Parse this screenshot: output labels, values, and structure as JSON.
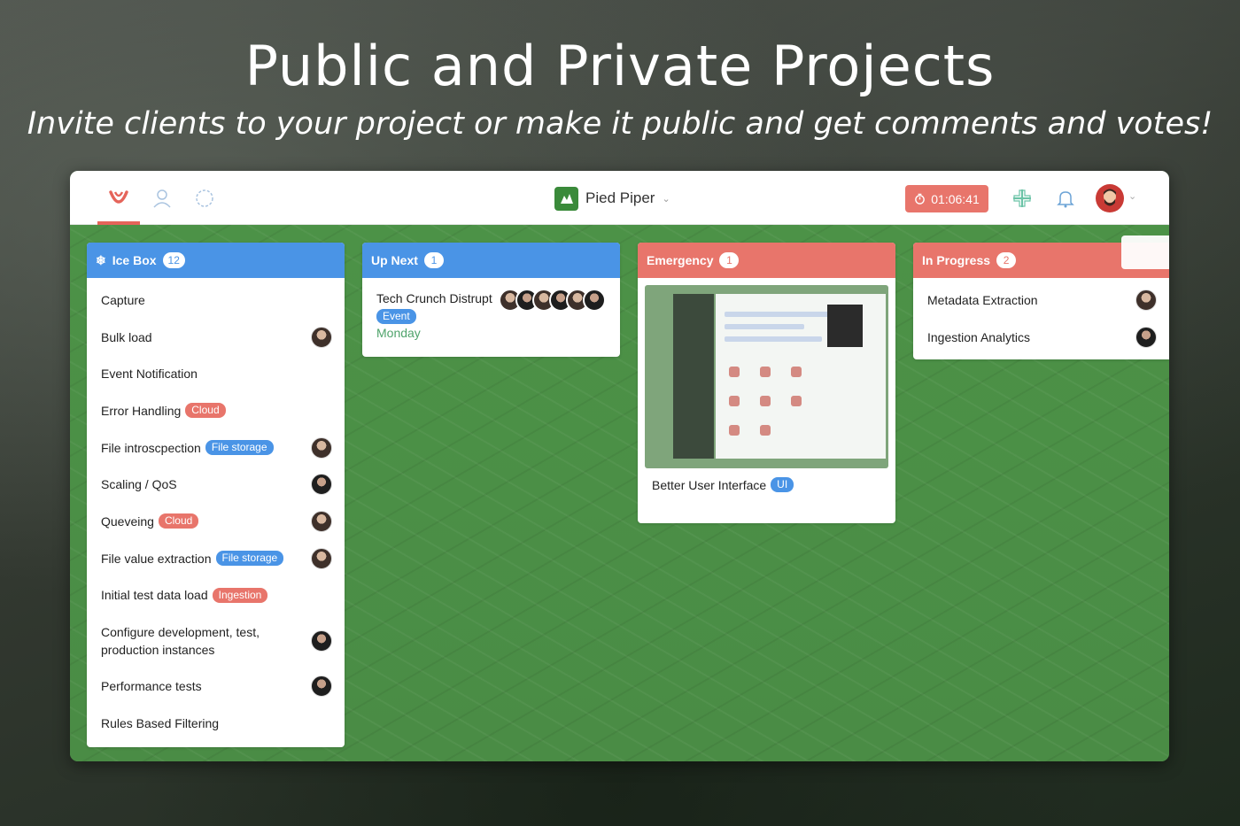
{
  "banner": {
    "title": "Public and Private Projects",
    "subtitle": "Invite clients to your project or make it public and get comments and votes!"
  },
  "topbar": {
    "nav_icons": [
      "logo-icon",
      "user-icon",
      "activity-icon"
    ],
    "project_name": "Pied Piper",
    "timer": "01:06:41",
    "right_icons": [
      "add-icon",
      "bell-icon",
      "avatar"
    ]
  },
  "columns": [
    {
      "title": "Ice Box",
      "count": "12",
      "color": "#4a94e6",
      "cards": [
        {
          "title": "Capture",
          "tag": ""
        },
        {
          "title": "Bulk load",
          "tag": ""
        },
        {
          "title": "Event Notification",
          "tag": ""
        },
        {
          "title": "Error Handling",
          "tag": "Cloud"
        },
        {
          "title": "File introscpection",
          "tag": "File storage"
        },
        {
          "title": "Scaling / QoS",
          "tag": ""
        },
        {
          "title": "Queveing",
          "tag": "Cloud"
        },
        {
          "title": "File value extraction",
          "tag": "File storage"
        },
        {
          "title": "Initial test data load",
          "tag": "Ingestion"
        },
        {
          "title": "Configure development, test, production instances",
          "tag": ""
        },
        {
          "title": "Performance tests",
          "tag": ""
        },
        {
          "title": "Rules Based Filtering",
          "tag": ""
        }
      ]
    },
    {
      "title": "Up Next",
      "count": "1",
      "color": "#4a94e6",
      "cards": [
        {
          "title": "Tech Crunch Distrupt",
          "tag": "Event",
          "date": "Monday"
        }
      ]
    },
    {
      "title": "Emergency",
      "count": "1",
      "color": "#e8756b",
      "cards": [
        {
          "title": "Better User Interface",
          "tag": "UI"
        }
      ]
    },
    {
      "title": "In Progress",
      "count": "2",
      "color": "#e8756b",
      "cards": [
        {
          "title": "Metadata Extraction",
          "tag": ""
        },
        {
          "title": "Ingestion Analytics",
          "tag": ""
        }
      ]
    }
  ]
}
